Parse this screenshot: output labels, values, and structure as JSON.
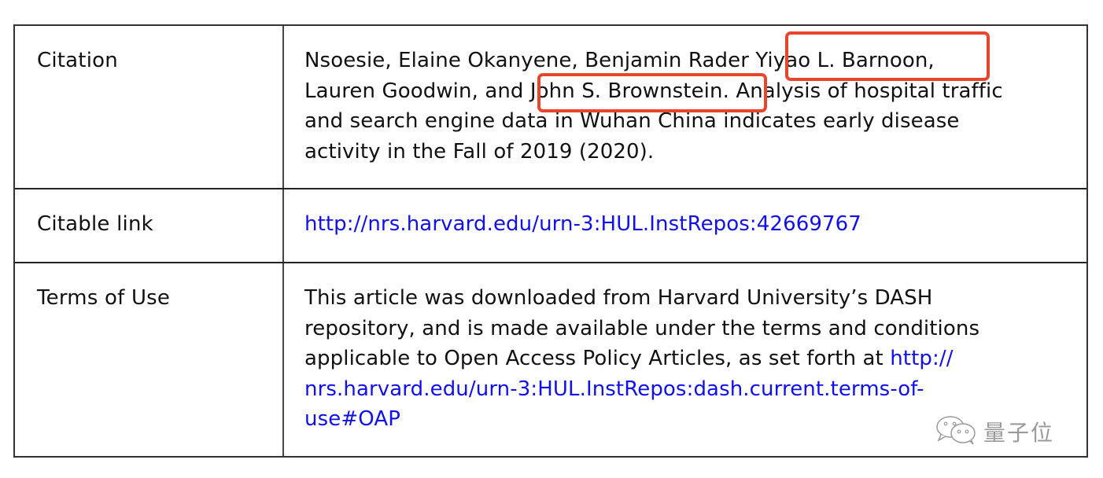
{
  "table": {
    "rows": [
      {
        "label": "Citation",
        "lines": [
          {
            "pre": "Nsoesie, Elaine Okanyene, Benjamin Rader",
            "highlight": " Yiyao L. Barnoon,",
            "post": ""
          },
          {
            "pre": "Lauren Goodwin, and ",
            "highlight": "John S. Brownstein.",
            "post": " Analysis of hospital traffic"
          },
          {
            "pre": "and search engine data in Wuhan China indicates early disease",
            "highlight": "",
            "post": ""
          },
          {
            "pre": "activity in the Fall of 2019 (2020).",
            "highlight": "",
            "post": ""
          }
        ]
      },
      {
        "label": "Citable link",
        "link": "http://nrs.harvard.edu/urn-3:HUL.InstRepos:42669767"
      },
      {
        "label": "Terms of Use",
        "lines": [
          {
            "text": "This article was downloaded from Harvard University’s DASH"
          },
          {
            "text": "repository, and is made available under the terms and conditions"
          },
          {
            "text": "applicable to Open Access Policy Articles, as set forth at ",
            "link": "http://"
          },
          {
            "link": "nrs.harvard.edu/urn-3:HUL.InstRepos:dash.current.terms-of-"
          },
          {
            "link": "use#OAP"
          }
        ]
      }
    ]
  },
  "highlights": {
    "color": "#e8452c",
    "names": [
      "Yiyao L. Barnoon",
      "John S. Brownstein"
    ]
  },
  "colors": {
    "link": "#1010ee",
    "text": "#111111",
    "border": "#333333"
  },
  "watermark": {
    "icon": "wechat-icon",
    "text": "量子位"
  }
}
